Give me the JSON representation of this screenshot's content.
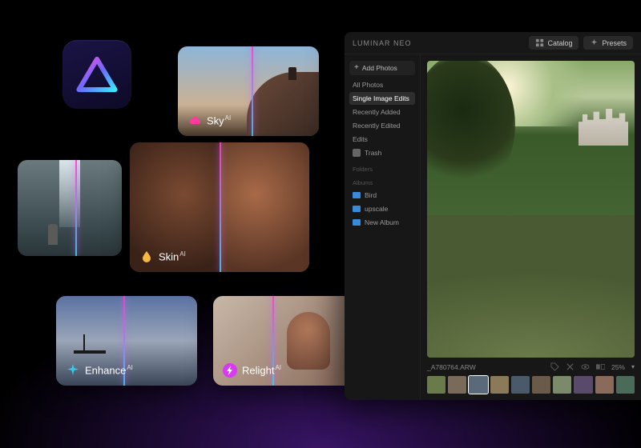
{
  "app": {
    "name": "Luminar Neo"
  },
  "features": {
    "sky": {
      "label": "Sky",
      "badge": "AI",
      "icon_color": "#ff3a9e",
      "slider_pos": 0.52
    },
    "skin": {
      "label": "Skin",
      "badge": "AI",
      "icon_color": "#f5b642",
      "slider_pos": 0.5
    },
    "enhance": {
      "label": "Enhance",
      "badge": "AI",
      "icon_color": "#3ac8e8",
      "slider_pos": 0.48
    },
    "relight": {
      "label": "Relight",
      "badge": "AI",
      "icon_color": "#d83af0",
      "slider_pos": 0.42
    }
  },
  "editor": {
    "title": "Luminar Neo",
    "header_buttons": {
      "catalog": "Catalog",
      "presets": "Presets"
    },
    "sidebar": {
      "add_button": "Add Photos",
      "library_items": [
        {
          "label": "All Photos",
          "active": false
        },
        {
          "label": "Single Image Edits",
          "active": true
        },
        {
          "label": "Recently Added",
          "active": false
        },
        {
          "label": "Recently Edited",
          "active": false
        },
        {
          "label": "Edits",
          "active": false
        }
      ],
      "trash": "Trash",
      "folders_heading": "Folders",
      "albums_heading": "Albums",
      "albums": [
        {
          "label": "Bird"
        },
        {
          "label": "upscale"
        },
        {
          "label": "New Album"
        }
      ]
    },
    "viewer": {
      "filename": "_A780764.ARW",
      "zoom": "25%",
      "thumb_count": 10
    }
  }
}
